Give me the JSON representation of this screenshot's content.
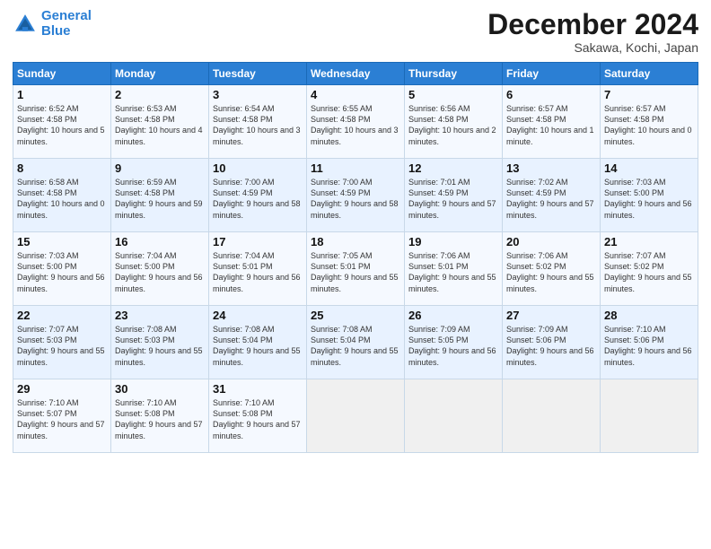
{
  "logo": {
    "line1": "General",
    "line2": "Blue"
  },
  "title": "December 2024",
  "location": "Sakawa, Kochi, Japan",
  "days_of_week": [
    "Sunday",
    "Monday",
    "Tuesday",
    "Wednesday",
    "Thursday",
    "Friday",
    "Saturday"
  ],
  "weeks": [
    [
      {
        "num": "1",
        "sunrise": "6:52 AM",
        "sunset": "4:58 PM",
        "daylight": "10 hours and 5 minutes."
      },
      {
        "num": "2",
        "sunrise": "6:53 AM",
        "sunset": "4:58 PM",
        "daylight": "10 hours and 4 minutes."
      },
      {
        "num": "3",
        "sunrise": "6:54 AM",
        "sunset": "4:58 PM",
        "daylight": "10 hours and 3 minutes."
      },
      {
        "num": "4",
        "sunrise": "6:55 AM",
        "sunset": "4:58 PM",
        "daylight": "10 hours and 3 minutes."
      },
      {
        "num": "5",
        "sunrise": "6:56 AM",
        "sunset": "4:58 PM",
        "daylight": "10 hours and 2 minutes."
      },
      {
        "num": "6",
        "sunrise": "6:57 AM",
        "sunset": "4:58 PM",
        "daylight": "10 hours and 1 minute."
      },
      {
        "num": "7",
        "sunrise": "6:57 AM",
        "sunset": "4:58 PM",
        "daylight": "10 hours and 0 minutes."
      }
    ],
    [
      {
        "num": "8",
        "sunrise": "6:58 AM",
        "sunset": "4:58 PM",
        "daylight": "10 hours and 0 minutes."
      },
      {
        "num": "9",
        "sunrise": "6:59 AM",
        "sunset": "4:58 PM",
        "daylight": "9 hours and 59 minutes."
      },
      {
        "num": "10",
        "sunrise": "7:00 AM",
        "sunset": "4:59 PM",
        "daylight": "9 hours and 58 minutes."
      },
      {
        "num": "11",
        "sunrise": "7:00 AM",
        "sunset": "4:59 PM",
        "daylight": "9 hours and 58 minutes."
      },
      {
        "num": "12",
        "sunrise": "7:01 AM",
        "sunset": "4:59 PM",
        "daylight": "9 hours and 57 minutes."
      },
      {
        "num": "13",
        "sunrise": "7:02 AM",
        "sunset": "4:59 PM",
        "daylight": "9 hours and 57 minutes."
      },
      {
        "num": "14",
        "sunrise": "7:03 AM",
        "sunset": "5:00 PM",
        "daylight": "9 hours and 56 minutes."
      }
    ],
    [
      {
        "num": "15",
        "sunrise": "7:03 AM",
        "sunset": "5:00 PM",
        "daylight": "9 hours and 56 minutes."
      },
      {
        "num": "16",
        "sunrise": "7:04 AM",
        "sunset": "5:00 PM",
        "daylight": "9 hours and 56 minutes."
      },
      {
        "num": "17",
        "sunrise": "7:04 AM",
        "sunset": "5:01 PM",
        "daylight": "9 hours and 56 minutes."
      },
      {
        "num": "18",
        "sunrise": "7:05 AM",
        "sunset": "5:01 PM",
        "daylight": "9 hours and 55 minutes."
      },
      {
        "num": "19",
        "sunrise": "7:06 AM",
        "sunset": "5:01 PM",
        "daylight": "9 hours and 55 minutes."
      },
      {
        "num": "20",
        "sunrise": "7:06 AM",
        "sunset": "5:02 PM",
        "daylight": "9 hours and 55 minutes."
      },
      {
        "num": "21",
        "sunrise": "7:07 AM",
        "sunset": "5:02 PM",
        "daylight": "9 hours and 55 minutes."
      }
    ],
    [
      {
        "num": "22",
        "sunrise": "7:07 AM",
        "sunset": "5:03 PM",
        "daylight": "9 hours and 55 minutes."
      },
      {
        "num": "23",
        "sunrise": "7:08 AM",
        "sunset": "5:03 PM",
        "daylight": "9 hours and 55 minutes."
      },
      {
        "num": "24",
        "sunrise": "7:08 AM",
        "sunset": "5:04 PM",
        "daylight": "9 hours and 55 minutes."
      },
      {
        "num": "25",
        "sunrise": "7:08 AM",
        "sunset": "5:04 PM",
        "daylight": "9 hours and 55 minutes."
      },
      {
        "num": "26",
        "sunrise": "7:09 AM",
        "sunset": "5:05 PM",
        "daylight": "9 hours and 56 minutes."
      },
      {
        "num": "27",
        "sunrise": "7:09 AM",
        "sunset": "5:06 PM",
        "daylight": "9 hours and 56 minutes."
      },
      {
        "num": "28",
        "sunrise": "7:10 AM",
        "sunset": "5:06 PM",
        "daylight": "9 hours and 56 minutes."
      }
    ],
    [
      {
        "num": "29",
        "sunrise": "7:10 AM",
        "sunset": "5:07 PM",
        "daylight": "9 hours and 57 minutes."
      },
      {
        "num": "30",
        "sunrise": "7:10 AM",
        "sunset": "5:08 PM",
        "daylight": "9 hours and 57 minutes."
      },
      {
        "num": "31",
        "sunrise": "7:10 AM",
        "sunset": "5:08 PM",
        "daylight": "9 hours and 57 minutes."
      },
      null,
      null,
      null,
      null
    ]
  ]
}
